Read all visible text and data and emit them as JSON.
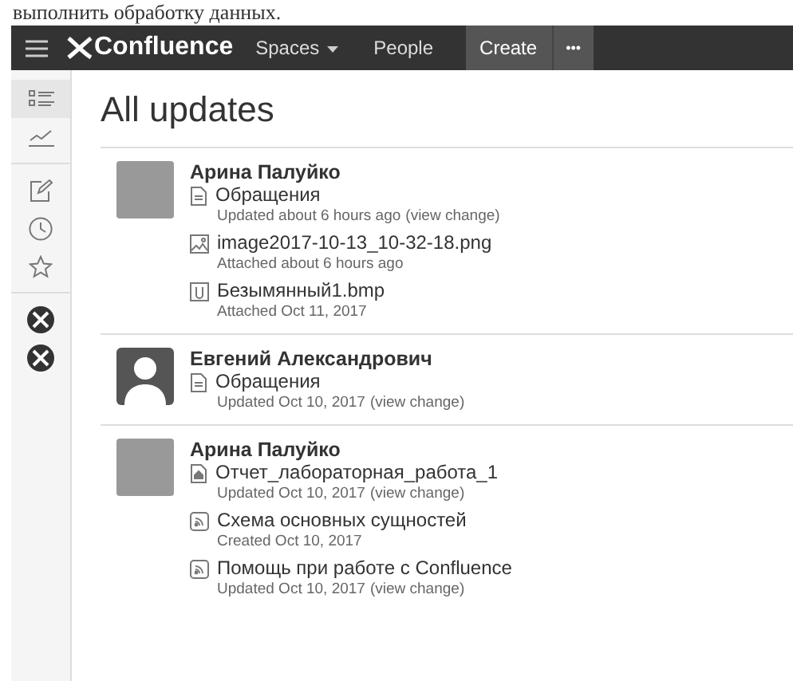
{
  "document_text": "выполнить обработку данных.",
  "navbar": {
    "logo": "Confluence",
    "items": [
      {
        "label": "Spaces",
        "dropdown": true
      },
      {
        "label": "People",
        "dropdown": false
      }
    ],
    "create": "Create",
    "more": "•••"
  },
  "sidebar": {
    "icons": [
      {
        "kind": "list",
        "selected": true
      },
      {
        "kind": "chart",
        "selected": false
      },
      {
        "kind": "edit",
        "selected": false
      },
      {
        "kind": "clock",
        "selected": false
      },
      {
        "kind": "star",
        "selected": false
      },
      {
        "kind": "space",
        "selected": false
      },
      {
        "kind": "space",
        "selected": false
      }
    ]
  },
  "title": "All updates",
  "updates": [
    {
      "author": "Арина Палуйко",
      "avatar": {
        "kind": "photo"
      },
      "items": [
        {
          "kind": "page",
          "title": "Обращения",
          "meta": "Updated about 6 hours ago",
          "link": "(view change)"
        },
        {
          "kind": "image",
          "title": "image2017-10-13_10-32-18.png",
          "meta": "Attached about 6 hours ago"
        },
        {
          "kind": "attachment",
          "title": "Безымянный1.bmp",
          "meta": "Attached Oct 11, 2017"
        }
      ]
    },
    {
      "author": "Евгений Александрович",
      "avatar": {
        "kind": "default"
      },
      "items": [
        {
          "kind": "page",
          "title": "Обращения",
          "meta": "Updated Oct 10, 2017",
          "link": "(view change)"
        }
      ]
    },
    {
      "author": "Арина Палуйко",
      "avatar": {
        "kind": "photo"
      },
      "items": [
        {
          "kind": "home",
          "title": "Отчет_лабораторная_работа_1",
          "meta": "Updated Oct 10, 2017",
          "link": "(view change)"
        },
        {
          "kind": "blog",
          "title": "Схема основных сущностей",
          "meta": "Created Oct 10, 2017"
        },
        {
          "kind": "blog",
          "title": "Помощь при работе с Confluence",
          "meta": "Updated Oct 10, 2017",
          "link": "(view change)"
        }
      ]
    }
  ]
}
